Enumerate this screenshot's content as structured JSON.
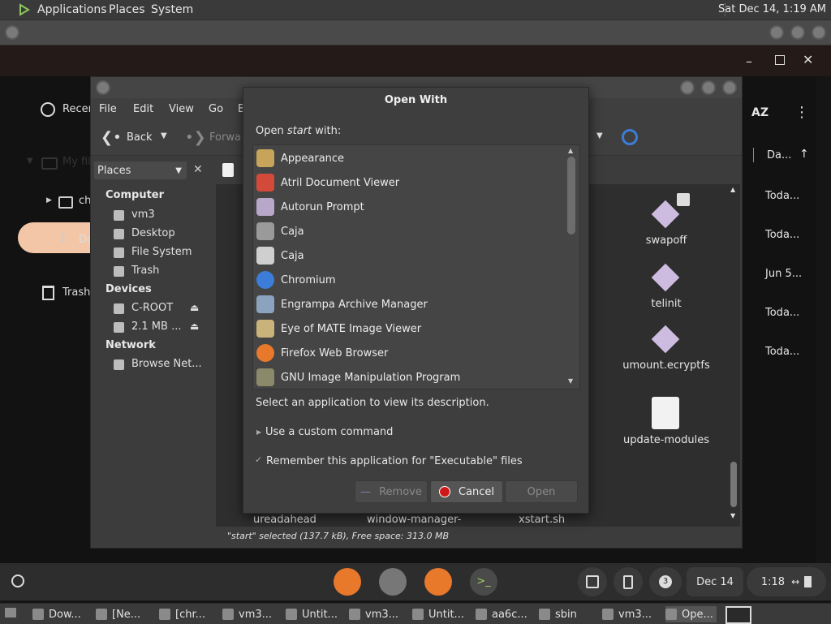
{
  "top_panel": {
    "menus": [
      "Applications",
      "Places",
      "System"
    ],
    "clock": "Sat Dec 14,  1:19 AM"
  },
  "files_app": {
    "sidebar": {
      "recent": "Recen",
      "my_files": "My fil",
      "child1": "ch",
      "downloads": "Do",
      "trash": "Trash"
    },
    "sort_label": "AZ",
    "date_header": "Da...",
    "dates": [
      "Toda...",
      "Toda...",
      "Jun 5...",
      "Toda...",
      "Toda..."
    ]
  },
  "caja": {
    "menus": [
      "File",
      "Edit",
      "View",
      "Go",
      "B"
    ],
    "toolbar": {
      "back": "Back",
      "forward": "Forwa"
    },
    "places_select": "Places",
    "sidebar": {
      "computer_head": "Computer",
      "computer_items": [
        "vm3",
        "Desktop",
        "File System",
        "Trash"
      ],
      "devices_head": "Devices",
      "devices_items": [
        "C-ROOT",
        "2.1 MB ..."
      ],
      "network_head": "Network",
      "network_items": [
        "Browse Net..."
      ]
    },
    "files": {
      "right_column": [
        "swapoff",
        "telinit",
        "umount.ecryptfs",
        "update-modules"
      ],
      "bottom_row": [
        "ureadahead",
        "window-manager-",
        "xstart.sh"
      ]
    },
    "status": "\"start\" selected (137.7 kB), Free space: 313.0 MB"
  },
  "dialog": {
    "title": "Open With",
    "prompt_prefix": "Open ",
    "prompt_file": "start",
    "prompt_suffix": " with:",
    "apps": [
      {
        "name": "Appearance",
        "icon": "appearance-icon",
        "color": "#c8a35a"
      },
      {
        "name": "Atril Document Viewer",
        "icon": "atril-icon",
        "color": "#d44a3a"
      },
      {
        "name": "Autorun Prompt",
        "icon": "autorun-icon",
        "color": "#b9a7c9"
      },
      {
        "name": "Caja",
        "icon": "folder-icon",
        "color": "#9a9a9a"
      },
      {
        "name": "Caja",
        "icon": "caja-icon",
        "color": "#cfcfcf"
      },
      {
        "name": "Chromium",
        "icon": "chromium-icon",
        "color": "#3b7dd8"
      },
      {
        "name": "Engrampa Archive Manager",
        "icon": "archive-icon",
        "color": "#8ca3c0"
      },
      {
        "name": "Eye of MATE Image Viewer",
        "icon": "image-viewer-icon",
        "color": "#c9b37a"
      },
      {
        "name": "Firefox Web Browser",
        "icon": "firefox-icon",
        "color": "#e8792b"
      },
      {
        "name": "GNU Image Manipulation Program",
        "icon": "gimp-icon",
        "color": "#8a8a6a"
      }
    ],
    "description": "Select an application to view its description.",
    "custom_command": "Use a custom command",
    "remember": "Remember this application for \"Executable\" files",
    "buttons": {
      "remove": "Remove",
      "cancel": "Cancel",
      "open": "Open"
    }
  },
  "shelf": {
    "notification_count": "3",
    "date": "Dec 14",
    "time": "1:18"
  },
  "taskbar": {
    "items": [
      "Dow...",
      "[Ne...",
      "[chr...",
      "vm3...",
      "Untit...",
      "vm3...",
      "Untit...",
      "aa6c...",
      "sbin",
      "vm3...",
      "Ope..."
    ]
  }
}
